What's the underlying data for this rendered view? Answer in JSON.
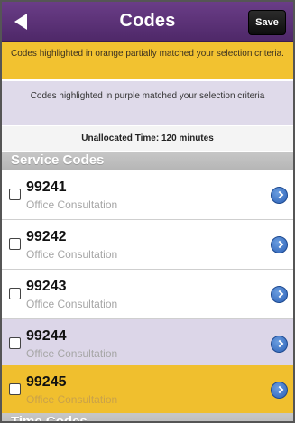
{
  "navbar": {
    "title": "Codes",
    "save_label": "Save"
  },
  "notices": {
    "orange": "Codes highlighted in orange partially matched your selection criteria.",
    "purple": "Codes highlighted in purple matched your selection criteria"
  },
  "unallocated": "Unallocated Time: 120 minutes",
  "sections": {
    "service": "Service Codes",
    "time": "Time Codes"
  },
  "service_codes": [
    {
      "code": "99241",
      "description": "Office Consultation",
      "highlight": "none"
    },
    {
      "code": "99242",
      "description": "Office Consultation",
      "highlight": "none"
    },
    {
      "code": "99243",
      "description": "Office Consultation",
      "highlight": "none"
    },
    {
      "code": "99244",
      "description": "Office Consultation",
      "highlight": "purple"
    },
    {
      "code": "99245",
      "description": "Office Consultation",
      "highlight": "orange"
    }
  ],
  "icons": {
    "back": "back-arrow-icon",
    "disclosure": "disclosure-chevron-icon"
  },
  "colors": {
    "navbar": "#5a2e78",
    "orange_highlight": "#f0bf2e",
    "purple_highlight": "#dcd6e8",
    "section_header": "#bdbdbd"
  }
}
